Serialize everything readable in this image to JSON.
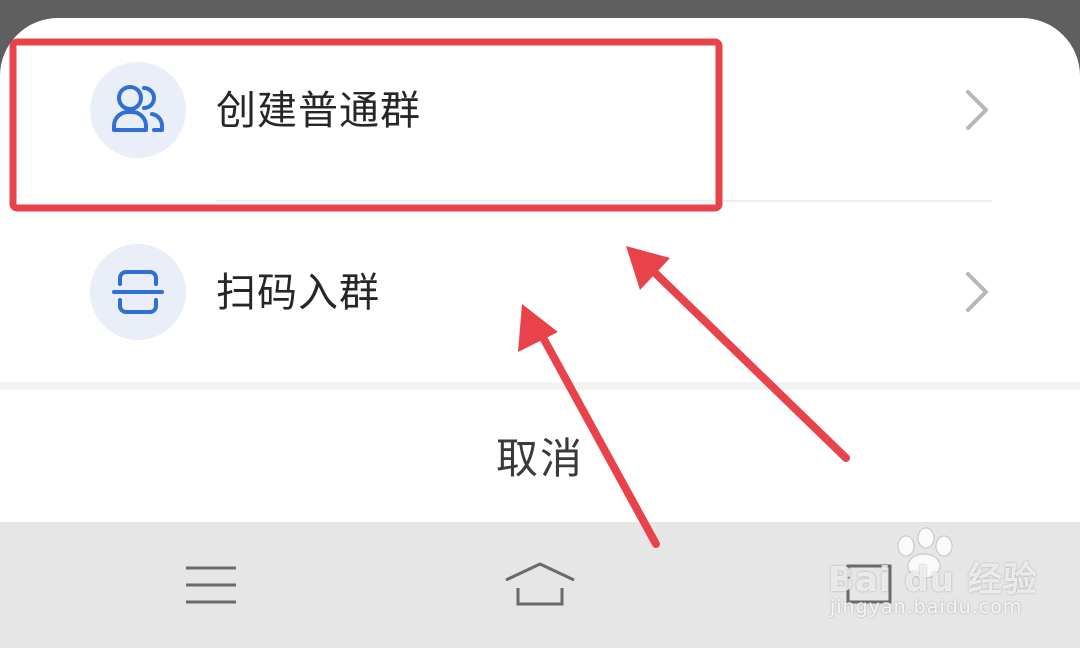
{
  "action_sheet": {
    "items": [
      {
        "label": "创建普通群",
        "icon": "group-icon"
      },
      {
        "label": "扫码入群",
        "icon": "scan-icon"
      }
    ],
    "cancel_label": "取消"
  },
  "nav_bar": {
    "buttons": [
      "menu-icon",
      "home-icon",
      "back-icon"
    ]
  },
  "annotation": {
    "highlight_color": "#e8434b",
    "arrow_color": "#e8434b"
  },
  "watermark": {
    "brand": "Bai du 经验",
    "url": "jingyan.baidu.com"
  },
  "colors": {
    "accent": "#2f6fd6",
    "icon_bg": "#e9eef8",
    "chevron": "#b8b8b8",
    "navbar_bg": "#e6e6e6"
  }
}
